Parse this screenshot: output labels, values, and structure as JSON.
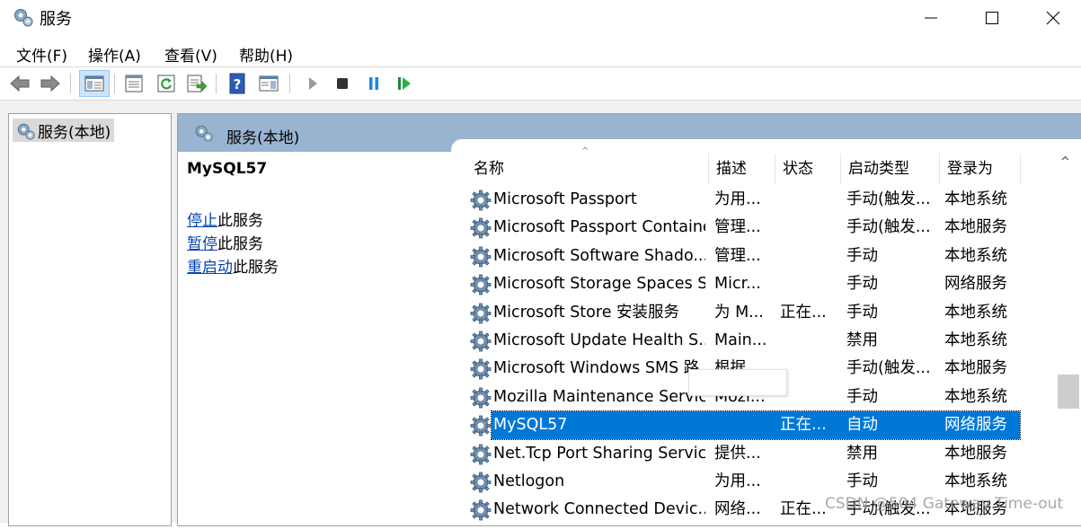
{
  "window": {
    "title": "服务"
  },
  "menu": [
    "文件(F)",
    "操作(A)",
    "查看(V)",
    "帮助(H)"
  ],
  "toolbar": {
    "buttons": [
      "back-icon",
      "forward-icon",
      "show-hide-tree-icon",
      "properties-icon",
      "refresh-icon",
      "export-list-icon",
      "help-icon",
      "show-hide-action-pane-icon",
      "start-service-icon",
      "stop-service-icon",
      "pause-service-icon",
      "resume-service-icon"
    ]
  },
  "tree": {
    "root_label": "服务(本地)"
  },
  "pane": {
    "header_title": "服务(本地)"
  },
  "details": {
    "service_name": "MySQL57",
    "actions": [
      {
        "link": "停止",
        "suffix": "此服务"
      },
      {
        "link": "暂停",
        "suffix": "此服务"
      },
      {
        "link": "重启动",
        "suffix": "此服务"
      }
    ]
  },
  "columns": {
    "name": "名称",
    "desc": "描述",
    "status": "状态",
    "startup": "启动类型",
    "logon": "登录为"
  },
  "services": [
    {
      "name": "Microsoft Passport",
      "desc": "为用...",
      "status": "",
      "startup": "手动(触发...",
      "logon": "本地系统"
    },
    {
      "name": "Microsoft Passport Container",
      "desc": "管理...",
      "status": "",
      "startup": "手动(触发...",
      "logon": "本地服务"
    },
    {
      "name": "Microsoft Software Shado...",
      "desc": "管理...",
      "status": "",
      "startup": "手动",
      "logon": "本地系统"
    },
    {
      "name": "Microsoft Storage Spaces S...",
      "desc": "Micr...",
      "status": "",
      "startup": "手动",
      "logon": "网络服务"
    },
    {
      "name": "Microsoft Store 安装服务",
      "desc": "为 M...",
      "status": "正在...",
      "startup": "手动",
      "logon": "本地系统"
    },
    {
      "name": "Microsoft Update Health S...",
      "desc": "Main...",
      "status": "",
      "startup": "禁用",
      "logon": "本地系统"
    },
    {
      "name": "Microsoft Windows SMS 路...",
      "desc": "根据...",
      "status": "",
      "startup": "手动(触发...",
      "logon": "本地服务"
    },
    {
      "name": "Mozilla Maintenance Service",
      "desc": "Mozi...",
      "status": "",
      "startup": "手动",
      "logon": "本地系统"
    },
    {
      "name": "MySQL57",
      "desc": "",
      "status": "正在...",
      "startup": "自动",
      "logon": "网络服务",
      "selected": true
    },
    {
      "name": "Net.Tcp Port Sharing Service",
      "desc": "提供...",
      "status": "",
      "startup": "禁用",
      "logon": "本地服务"
    },
    {
      "name": "Netlogon",
      "desc": "为用...",
      "status": "",
      "startup": "手动",
      "logon": "本地系统"
    },
    {
      "name": "Network Connected Devic...",
      "desc": "网络...",
      "status": "正在...",
      "startup": "手动(触发...",
      "logon": "本地服务"
    }
  ],
  "watermark": "CSDN @504 Gateway Time-out",
  "colors": {
    "header_bar": "#99b4d1",
    "selection": "#0078d7",
    "link": "#0645ad"
  }
}
